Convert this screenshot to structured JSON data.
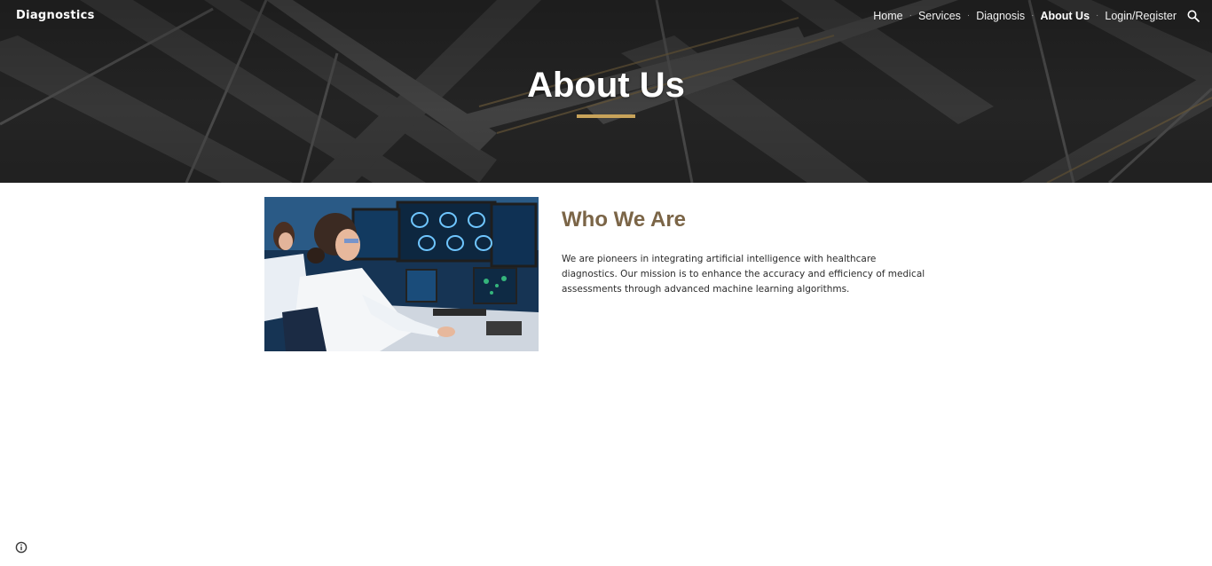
{
  "header": {
    "brand": "Diagnostics",
    "nav": [
      {
        "label": "Home"
      },
      {
        "label": "Services"
      },
      {
        "label": "Diagnosis"
      },
      {
        "label": "About Us",
        "active": true
      },
      {
        "label": "Login/Register"
      }
    ],
    "search_icon": "search-icon"
  },
  "hero": {
    "title": "About Us",
    "accent_color": "#c8a35a"
  },
  "about": {
    "heading": "Who We Are",
    "heading_color": "#7b6547",
    "body": "We are pioneers in integrating artificial intelligence with healthcare diagnostics. Our mission is to enhance the accuracy and efficiency of medical assessments through advanced machine learning algorithms."
  },
  "footer": {
    "info_icon": "info-icon"
  }
}
